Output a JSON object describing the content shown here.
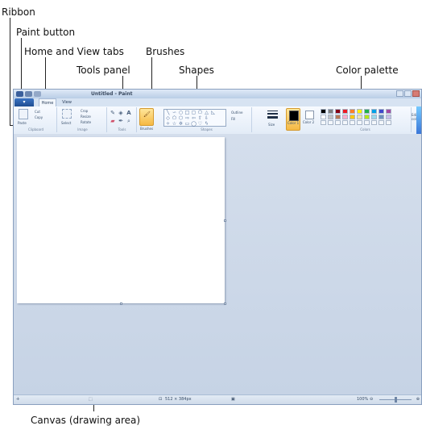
{
  "callouts": {
    "ribbon": "Ribbon",
    "paint_button": "Paint button",
    "home_view_tabs": "Home and View tabs",
    "tools_panel": "Tools panel",
    "brushes": "Brushes",
    "shapes": "Shapes",
    "color_palette": "Color palette",
    "canvas": "Canvas (drawing area)"
  },
  "window": {
    "title": "Untitled - Paint",
    "tabs": [
      {
        "label": "Home",
        "active": true
      },
      {
        "label": "View",
        "active": false
      }
    ]
  },
  "ribbon": {
    "clipboard": {
      "paste": "Paste",
      "cut": "Cut",
      "copy": "Copy",
      "label": "Clipboard"
    },
    "image": {
      "select": "Select",
      "crop": "Crop",
      "resize": "Resize",
      "rotate": "Rotate",
      "label": "Image"
    },
    "tools": {
      "label": "Tools"
    },
    "brushes": {
      "label": "Brushes"
    },
    "shapes": {
      "outline": "Outline",
      "fill": "Fill",
      "label": "Shapes"
    },
    "size": {
      "label": "Size"
    },
    "color1": {
      "label": "Color 1"
    },
    "color2": {
      "label": "Color 2"
    },
    "colors": {
      "label": "Colors"
    },
    "edit_colors": "Edit colors"
  },
  "palette": [
    "#000000",
    "#7f7f7f",
    "#880015",
    "#ed1c24",
    "#ff7f27",
    "#fff200",
    "#22b14c",
    "#00a2e8",
    "#3f48cc",
    "#a349a4",
    "#ffffff",
    "#c3c3c3",
    "#b97a57",
    "#ffaec9",
    "#ffc90e",
    "#efe4b0",
    "#b5e61d",
    "#99d9ea",
    "#7092be",
    "#c8bfe7"
  ],
  "active_colors": {
    "color1": "#000000",
    "color2": "#ffffff"
  },
  "status": {
    "canvas_size": "512 × 384px",
    "zoom": "100%"
  }
}
